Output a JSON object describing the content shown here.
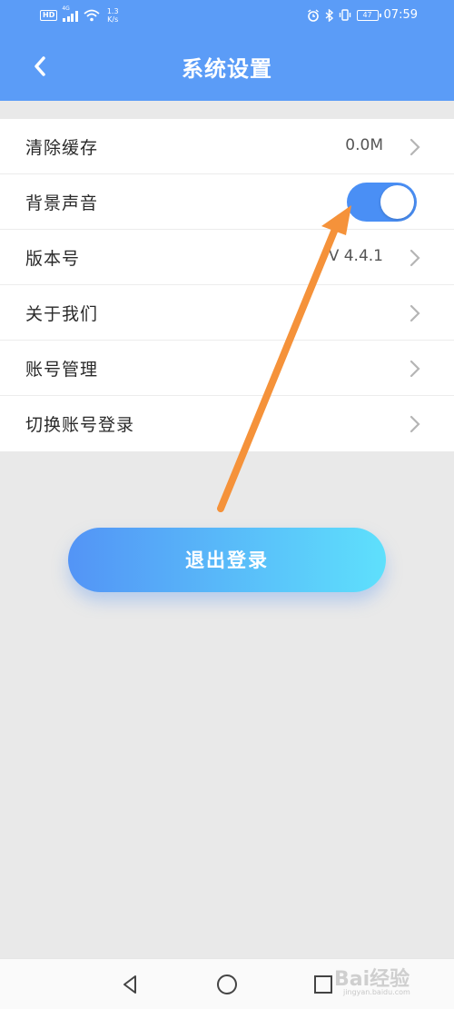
{
  "status_bar": {
    "hd": "HD",
    "network": "4G",
    "speed_value": "1.3",
    "speed_unit": "K/s",
    "battery": "47",
    "time": "07:59"
  },
  "header": {
    "title": "系统设置",
    "back_icon": "chevron-left-icon"
  },
  "settings": {
    "items": [
      {
        "label": "清除缓存",
        "value": "0.0M",
        "has_chevron": true
      },
      {
        "label": "背景声音",
        "toggle_on": true
      },
      {
        "label": "版本号",
        "value": "V 4.4.1",
        "has_chevron": true
      },
      {
        "label": "关于我们",
        "has_chevron": true
      },
      {
        "label": "账号管理",
        "has_chevron": true
      },
      {
        "label": "切换账号登录",
        "has_chevron": true
      }
    ]
  },
  "logout": {
    "label": "退出登录"
  },
  "colors": {
    "primary": "#5b9cf7",
    "toggle_on": "#4a8ff5",
    "button_gradient_start": "#5394f6",
    "button_gradient_end": "#5ee0fc",
    "annotation_arrow": "#f5923a",
    "background": "#e9e9e9"
  },
  "annotation": {
    "type": "arrow",
    "points_to": "背景声音 toggle"
  },
  "nav_bar": {
    "icons": [
      "back-triangle-icon",
      "home-circle-icon",
      "recents-square-icon"
    ]
  },
  "watermark": {
    "brand": "Bai",
    "brand_suffix": "经验",
    "url": "jingyan.baidu.com"
  }
}
